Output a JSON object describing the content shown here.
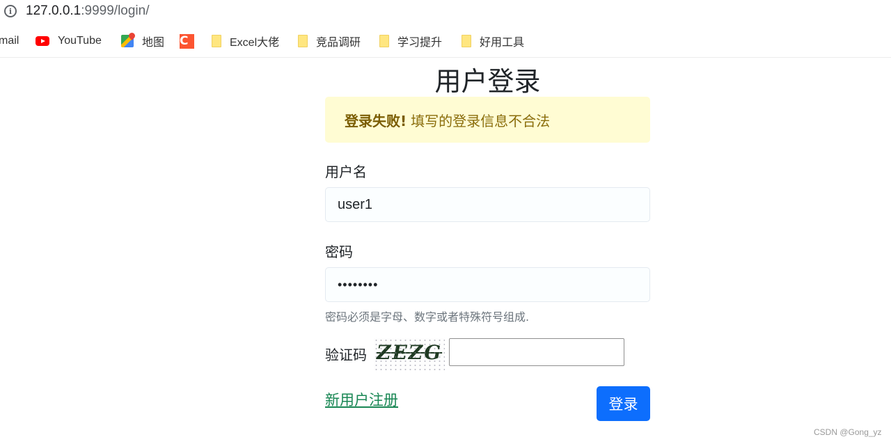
{
  "browser": {
    "url_host": "127.0.0.1",
    "url_path": ":9999/login/",
    "info_icon": "info-icon",
    "bookmarks": [
      {
        "label": "mail",
        "icon": "gmail-icon"
      },
      {
        "label": "YouTube",
        "icon": "youtube-icon"
      },
      {
        "label": "地图",
        "icon": "maps-icon"
      },
      {
        "label": "",
        "icon": "csdn-icon"
      },
      {
        "label": "Excel大佬",
        "icon": "folder-icon"
      },
      {
        "label": "竞品调研",
        "icon": "folder-icon"
      },
      {
        "label": "学习提升",
        "icon": "folder-icon"
      },
      {
        "label": "好用工具",
        "icon": "folder-icon"
      }
    ]
  },
  "page": {
    "title": "用户登录",
    "alert": {
      "strong": "登录失败!",
      "message": "填写的登录信息不合法"
    },
    "form": {
      "username_label": "用户名",
      "username_value": "user1",
      "password_label": "密码",
      "password_value": "••••••••",
      "password_help": "密码必须是字母、数字或者特殊符号组成.",
      "captcha_label": "验证码",
      "captcha_text": "ZEZG",
      "captcha_value": "",
      "register_link": "新用户注册",
      "submit_label": "登录"
    },
    "colors": {
      "alert_bg": "#fffcd3",
      "alert_text": "#8a6d0b",
      "primary": "#0d6efd",
      "link": "#198754"
    }
  },
  "watermark": "CSDN @Gong_yz"
}
